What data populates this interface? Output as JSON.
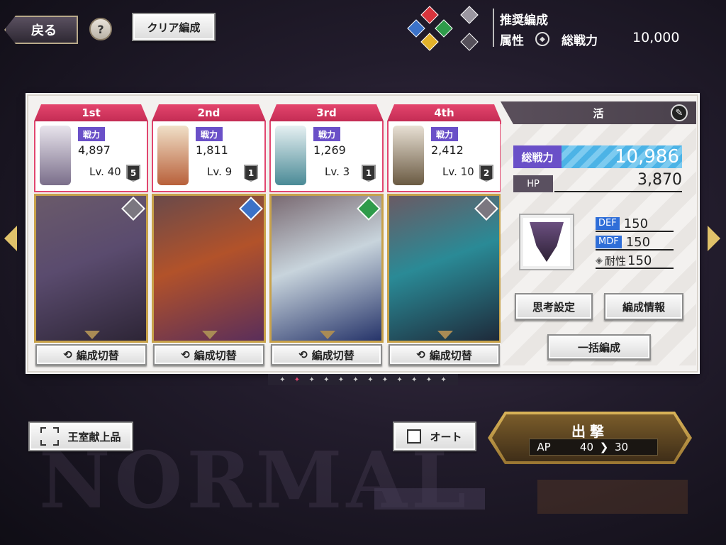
{
  "header": {
    "back_label": "戻る",
    "help_label": "?",
    "clear_label": "クリア編成"
  },
  "recommend": {
    "title": "推奨編成",
    "attr_label": "属性",
    "power_label": "総戦力",
    "power_value": "10,000"
  },
  "slots": [
    {
      "position": "1st",
      "power_label": "戦力",
      "power": "4,897",
      "level": "Lv. 40",
      "rank": "5",
      "switch_label": "編成切替",
      "attr_color": "#7b7780",
      "card_color": "#5a4b6e"
    },
    {
      "position": "2nd",
      "power_label": "戦力",
      "power": "1,811",
      "level": "Lv. 9",
      "rank": "1",
      "switch_label": "編成切替",
      "attr_color": "#3b72c8",
      "card_color": "#8a4a3a"
    },
    {
      "position": "3rd",
      "power_label": "戦力",
      "power": "1,269",
      "level": "Lv. 3",
      "rank": "1",
      "switch_label": "編成切替",
      "attr_color": "#2e9b4a",
      "card_color": "#5a6f80"
    },
    {
      "position": "4th",
      "power_label": "戦力",
      "power": "2,412",
      "level": "Lv. 10",
      "rank": "2",
      "switch_label": "編成切替",
      "attr_color": "#7b7780",
      "card_color": "#3a6a7a"
    }
  ],
  "summary": {
    "type_label": "活",
    "total_power_label": "総戦力",
    "total_power": "10,986",
    "hp_label": "HP",
    "hp": "3,870",
    "def_label": "DEF",
    "def": "150",
    "mdf_label": "MDF",
    "mdf": "150",
    "resist_label": "耐性",
    "resist": "150",
    "think_label": "思考設定",
    "info_label": "編成情報",
    "bulk_label": "一括編成"
  },
  "pager": {
    "total": 12,
    "active": 2
  },
  "bottom": {
    "offering_label": "王室献上品",
    "auto_label": "オート",
    "sortie_label": "出撃",
    "ap_label": "AP",
    "ap_from": "40",
    "ap_to": "30"
  },
  "background": {
    "word": "NORMAL",
    "box_value": "10"
  },
  "colors": {
    "accent": "#e1466f",
    "power_tag": "#6a50c8",
    "gold": "#d9b358"
  }
}
